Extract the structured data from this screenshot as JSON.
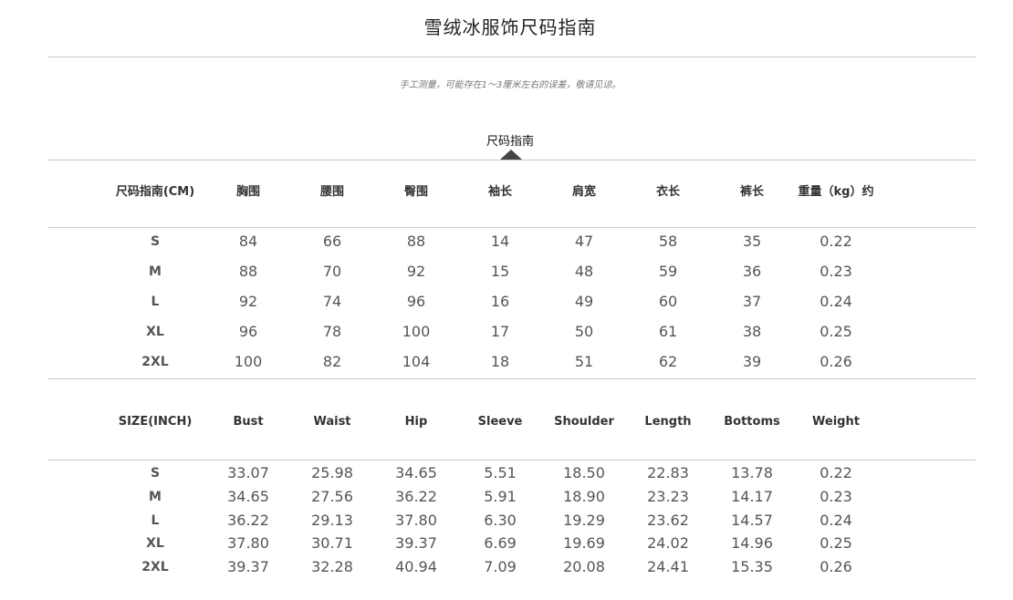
{
  "title": "雪绒冰服饰尺码指南",
  "note": "手工测量，可能存在1～3厘米左右的误差，敬请见谅。",
  "section_label": "尺码指南",
  "table_cm": {
    "headers": [
      "尺码指南(CM)",
      "胸围",
      "腰围",
      "臀围",
      "袖长",
      "肩宽",
      "衣长",
      "裤长",
      "重量（kg）约"
    ],
    "rows": [
      [
        "S",
        "84",
        "66",
        "88",
        "14",
        "47",
        "58",
        "35",
        "0.22"
      ],
      [
        "M",
        "88",
        "70",
        "92",
        "15",
        "48",
        "59",
        "36",
        "0.23"
      ],
      [
        "L",
        "92",
        "74",
        "96",
        "16",
        "49",
        "60",
        "37",
        "0.24"
      ],
      [
        "XL",
        "96",
        "78",
        "100",
        "17",
        "50",
        "61",
        "38",
        "0.25"
      ],
      [
        "2XL",
        "100",
        "82",
        "104",
        "18",
        "51",
        "62",
        "39",
        "0.26"
      ]
    ]
  },
  "table_inch": {
    "headers": [
      "SIZE(INCH)",
      "Bust",
      "Waist",
      "Hip",
      "Sleeve",
      "Shoulder",
      "Length",
      "Bottoms",
      "Weight"
    ],
    "rows": [
      [
        "S",
        "33.07",
        "25.98",
        "34.65",
        "5.51",
        "18.50",
        "22.83",
        "13.78",
        "0.22"
      ],
      [
        "M",
        "34.65",
        "27.56",
        "36.22",
        "5.91",
        "18.90",
        "23.23",
        "14.17",
        "0.23"
      ],
      [
        "L",
        "36.22",
        "29.13",
        "37.80",
        "6.30",
        "19.29",
        "23.62",
        "14.57",
        "0.24"
      ],
      [
        "XL",
        "37.80",
        "30.71",
        "39.37",
        "6.69",
        "19.69",
        "24.02",
        "14.96",
        "0.25"
      ],
      [
        "2XL",
        "39.37",
        "32.28",
        "40.94",
        "7.09",
        "20.08",
        "24.41",
        "15.35",
        "0.26"
      ]
    ]
  }
}
